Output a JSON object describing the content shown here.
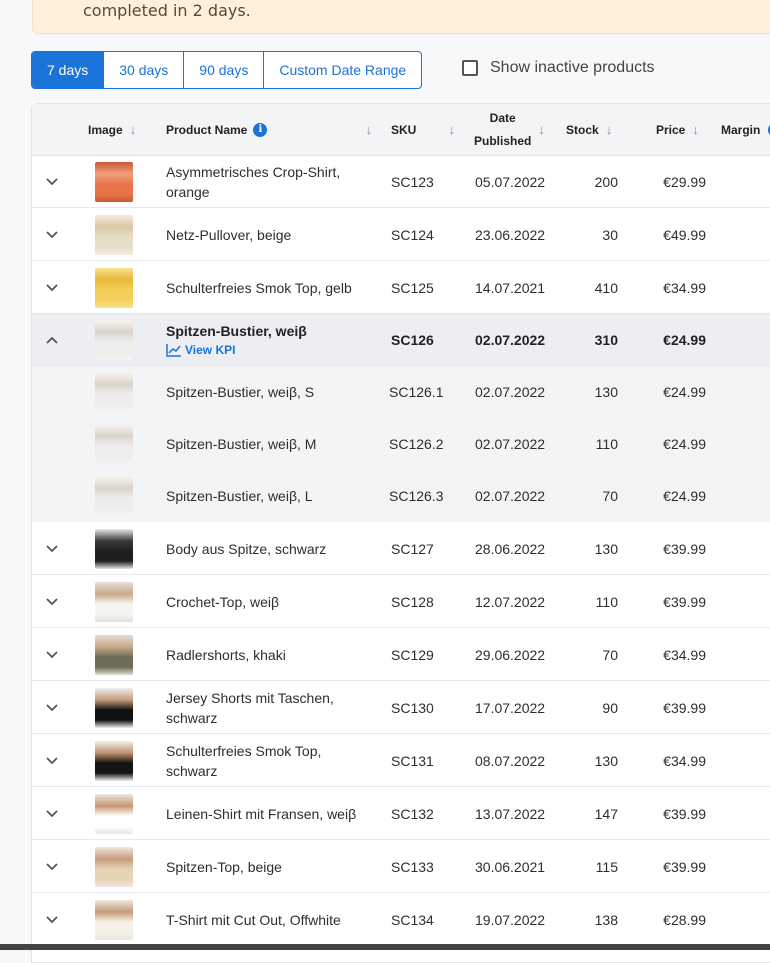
{
  "banner": {
    "text": "completed in 2 days."
  },
  "date_range": {
    "options": [
      "7 days",
      "30 days",
      "90 days",
      "Custom Date Range"
    ],
    "selected": "7 days"
  },
  "inactive_toggle": {
    "label": "Show inactive products",
    "checked": false
  },
  "table": {
    "headers": {
      "image": "Image",
      "product_name": "Product Name",
      "sku": "SKU",
      "date_published_1": "Date",
      "date_published_2": "Published",
      "stock": "Stock",
      "price": "Price",
      "margin": "Margin"
    },
    "rows": [
      {
        "name_l1": "Asymmetrisches Crop-Shirt,",
        "name_l2": "orange",
        "sku": "SC123",
        "date": "05.07.2022",
        "stock": "200",
        "price": "€29.99"
      },
      {
        "name_l1": "Netz-Pullover, beige",
        "name_l2": "",
        "sku": "SC124",
        "date": "23.06.2022",
        "stock": "30",
        "price": "€49.99"
      },
      {
        "name_l1": "Schulterfreies Smok Top, gelb",
        "name_l2": "",
        "sku": "SC125",
        "date": "14.07.2021",
        "stock": "410",
        "price": "€34.99"
      },
      {
        "name_l1": "Spitzen-Bustier, weiβ",
        "name_l2": "",
        "sku": "SC126",
        "date": "02.07.2022",
        "stock": "310",
        "price": "€24.99",
        "kpi_label": "View KPI"
      },
      {
        "name_l1": "Spitzen-Bustier, weiβ, S",
        "name_l2": "",
        "sku": "SC126.1",
        "date": "02.07.2022",
        "stock": "130",
        "price": "€24.99"
      },
      {
        "name_l1": "Spitzen-Bustier, weiβ, M",
        "name_l2": "",
        "sku": "SC126.2",
        "date": "02.07.2022",
        "stock": "110",
        "price": "€24.99"
      },
      {
        "name_l1": "Spitzen-Bustier, weiβ, L",
        "name_l2": "",
        "sku": "SC126.3",
        "date": "02.07.2022",
        "stock": "70",
        "price": "€24.99"
      },
      {
        "name_l1": "Body aus Spitze, schwarz",
        "name_l2": "",
        "sku": "SC127",
        "date": "28.06.2022",
        "stock": "130",
        "price": "€39.99"
      },
      {
        "name_l1": "Crochet-Top, weiβ",
        "name_l2": "",
        "sku": "SC128",
        "date": "12.07.2022",
        "stock": "110",
        "price": "€39.99"
      },
      {
        "name_l1": "Radlershorts, khaki",
        "name_l2": "",
        "sku": "SC129",
        "date": "29.06.2022",
        "stock": "70",
        "price": "€34.99"
      },
      {
        "name_l1": "Jersey Shorts mit Taschen,",
        "name_l2": "schwarz",
        "sku": "SC130",
        "date": "17.07.2022",
        "stock": "90",
        "price": "€39.99"
      },
      {
        "name_l1": "Schulterfreies Smok Top,",
        "name_l2": "schwarz",
        "sku": "SC131",
        "date": "08.07.2022",
        "stock": "130",
        "price": "€34.99"
      },
      {
        "name_l1": "Leinen-Shirt mit Fransen, weiβ",
        "name_l2": "",
        "sku": "SC132",
        "date": "13.07.2022",
        "stock": "147",
        "price": "€39.99"
      },
      {
        "name_l1": "Spitzen-Top, beige",
        "name_l2": "",
        "sku": "SC133",
        "date": "30.06.2021",
        "stock": "115",
        "price": "€39.99"
      },
      {
        "name_l1": "T-Shirt mit Cut Out, Offwhite",
        "name_l2": "",
        "sku": "SC134",
        "date": "19.07.2022",
        "stock": "138",
        "price": "€28.99"
      }
    ]
  },
  "colors": {
    "accent": "#1a73d9",
    "banner_bg": "#fdf1dd",
    "header_bg": "#f3f4f6"
  },
  "icons": [
    "info-icon",
    "chevron-down-icon",
    "chevron-up-icon",
    "sort-arrow-icon",
    "line-chart-icon",
    "checkbox-icon"
  ]
}
